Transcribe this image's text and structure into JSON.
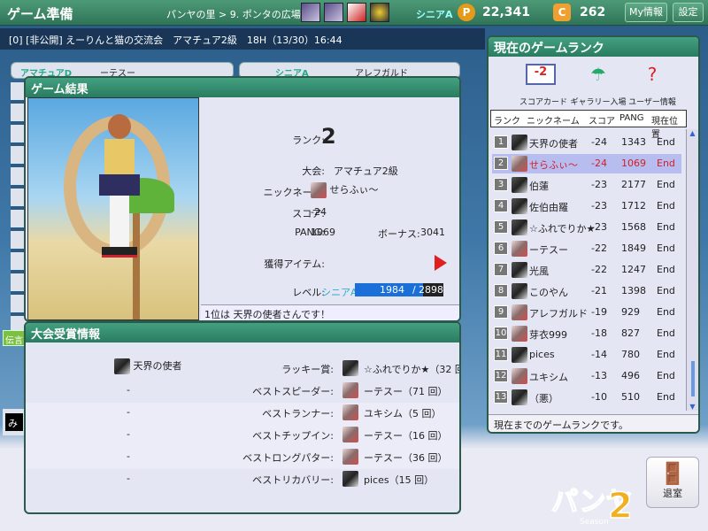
{
  "header": {
    "title": "ゲーム準備",
    "breadcrumb": "パンヤの里 > 9. ポンタの広場",
    "rank": "シニアA",
    "pang": "22,341",
    "cookie": "262",
    "my_info": "My情報",
    "settings": "設定"
  },
  "room_info": "[0] [非公開] えーりんと猫の交流会　アマチュア2級　18H（13/30）16:44",
  "slots": [
    {
      "rank": "アマチュアD",
      "name": "ーテスー"
    },
    {
      "rank": "シニアA",
      "name": "アレフガルド"
    }
  ],
  "side_labels": {
    "message": "伝言",
    "chat": "み"
  },
  "result": {
    "title": "ゲーム結果",
    "rank_label": "ランク:",
    "rank": "2",
    "tournament_label": "大会:",
    "tournament": "アマチュア2級",
    "nickname_label": "ニックネーム:",
    "nickname": "せらふぃ〜",
    "score_label": "スコア:",
    "score": "-24",
    "pang_label": "PANG:",
    "pang": "1069",
    "bonus_label": "ボーナス:",
    "bonus": "3041",
    "items_label": "獲得アイテム:",
    "level_label": "レベル:",
    "level_rank": "シニアA",
    "exp_current": "1984",
    "exp_total": "2898",
    "footer": "1位は 天界の使者さんです！"
  },
  "awards": {
    "title": "大会受賞情報",
    "winner": "天界の使者",
    "rows": [
      {
        "left": "",
        "label": "ラッキー賞:",
        "avatar": "cat",
        "value": "☆ふれでりか★（32 回）"
      },
      {
        "left": "-",
        "label": "ベストスピーダー:",
        "avatar": "girl",
        "value": "ーテスー（71 回）"
      },
      {
        "left": "-",
        "label": "ベストランナー:",
        "avatar": "girl",
        "value": "ユキシム（5 回）"
      },
      {
        "left": "-",
        "label": "ベストチップイン:",
        "avatar": "girl",
        "value": "ーテスー（16 回）"
      },
      {
        "left": "-",
        "label": "ベストロングパター:",
        "avatar": "girl",
        "value": "ーテスー（36 回）"
      },
      {
        "left": "-",
        "label": "ベストリカバリー:",
        "avatar": "cat",
        "value": "pices（15 回）"
      }
    ]
  },
  "ranking": {
    "title": "現在のゲームランク",
    "buttons": [
      "スコアカード",
      "ギャラリー入場",
      "ユーザー情報"
    ],
    "scorecard_value": "-2",
    "columns": [
      "ランク",
      "ニックネーム",
      "スコア",
      "PANG",
      "現在位置"
    ],
    "rows": [
      {
        "rank": "1",
        "name": "天界の使者",
        "score": "-24",
        "pang": "1343",
        "pos": "End",
        "avatar": "cat"
      },
      {
        "rank": "2",
        "name": "せらふぃ〜",
        "score": "-24",
        "pang": "1069",
        "pos": "End",
        "avatar": "girl",
        "me": true
      },
      {
        "rank": "3",
        "name": "伯蓮",
        "score": "-23",
        "pang": "2177",
        "pos": "End",
        "avatar": "cat"
      },
      {
        "rank": "4",
        "name": "佐伯由羅",
        "score": "-23",
        "pang": "1712",
        "pos": "End",
        "avatar": "cat"
      },
      {
        "rank": "5",
        "name": "☆ふれでりか★",
        "score": "-23",
        "pang": "1568",
        "pos": "End",
        "avatar": "cat"
      },
      {
        "rank": "6",
        "name": "ーテスー",
        "score": "-22",
        "pang": "1849",
        "pos": "End",
        "avatar": "girl"
      },
      {
        "rank": "7",
        "name": "光風",
        "score": "-22",
        "pang": "1247",
        "pos": "End",
        "avatar": "cat"
      },
      {
        "rank": "8",
        "name": "このやん",
        "score": "-21",
        "pang": "1398",
        "pos": "End",
        "avatar": "cat"
      },
      {
        "rank": "9",
        "name": "アレフガルド",
        "score": "-19",
        "pang": "929",
        "pos": "End",
        "avatar": "girl"
      },
      {
        "rank": "10",
        "name": "芽衣999",
        "score": "-18",
        "pang": "827",
        "pos": "End",
        "avatar": "girl"
      },
      {
        "rank": "11",
        "name": "pices",
        "score": "-14",
        "pang": "780",
        "pos": "End",
        "avatar": "cat"
      },
      {
        "rank": "12",
        "name": "ユキシム",
        "score": "-13",
        "pang": "496",
        "pos": "End",
        "avatar": "girl"
      },
      {
        "rank": "13",
        "name": "（悪）",
        "score": "-10",
        "pang": "510",
        "pos": "End",
        "avatar": "cat"
      }
    ],
    "footer": "現在までのゲームランクです。"
  },
  "exit_label": "退室",
  "logo_text": "パンヤ2 Season",
  "colors": {
    "accent_green": "#2f7c5f",
    "highlight": "#d0202a",
    "exp_bar": "#1a6fd8"
  }
}
